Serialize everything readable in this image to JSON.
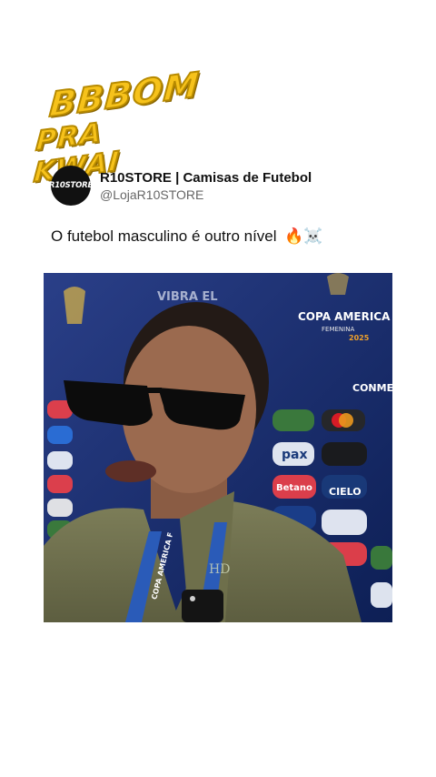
{
  "logo": {
    "line1": "BBBOM",
    "line2": "PRA KWAI"
  },
  "post": {
    "avatar_text": "R10STORE",
    "display_name": "R10STORE | Camisas de Futebol",
    "handle": "@LojaR10STORE",
    "text": "O futebol masculino é outro nível",
    "emoji": "🔥☠️"
  },
  "media": {
    "watermark": "HD",
    "backdrop_texts": {
      "tournament": "COPA AMERICA",
      "tournament_sub": "FEMENINA",
      "year": "2025",
      "vibra": "VIBRA EL",
      "conmebol": "CONMEBOL",
      "sponsor_pax": "pax",
      "sponsor_betano": "Betano",
      "sponsor_cielo": "CIELO",
      "lanyard": "COPA AMERICA F"
    }
  }
}
